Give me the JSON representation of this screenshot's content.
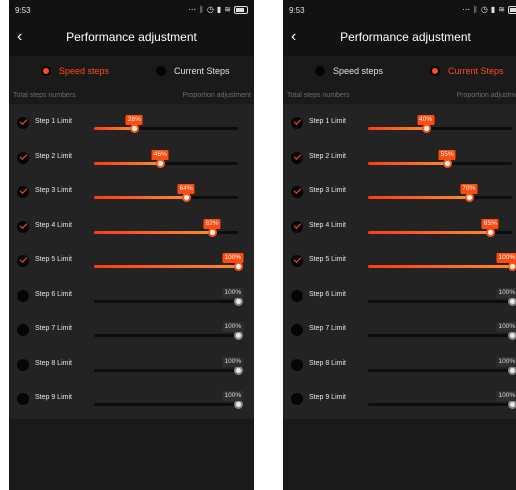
{
  "status_bar": {
    "time": "9:53",
    "icons": [
      "more-dots-icon",
      "bluetooth-icon",
      "alarm-icon",
      "signal-icon",
      "wifi-icon",
      "battery-icon"
    ]
  },
  "nav": {
    "back_icon": "chevron-left-icon",
    "title": "Performance adjustment"
  },
  "modes": {
    "speed_steps": "Speed steps",
    "current_steps": "Current Steps"
  },
  "headers": {
    "left": "Total steps numbers",
    "right": "Proportion adjustment"
  },
  "colors": {
    "accent": "#ff4d1a",
    "background": "#1a1a1a",
    "panel": "#232323"
  },
  "screens": [
    {
      "selected_mode": "speed_steps",
      "steps": [
        {
          "label": "Step 1 Limit",
          "enabled": true,
          "value": 28,
          "badge": "28%"
        },
        {
          "label": "Step 2 Limit",
          "enabled": true,
          "value": 46,
          "badge": "46%"
        },
        {
          "label": "Step 3 Limit",
          "enabled": true,
          "value": 64,
          "badge": "64%"
        },
        {
          "label": "Step 4 Limit",
          "enabled": true,
          "value": 82,
          "badge": "82%"
        },
        {
          "label": "Step 5 Limit",
          "enabled": true,
          "value": 100,
          "badge": "100%"
        },
        {
          "label": "Step 6 Limit",
          "enabled": false,
          "value": 100,
          "badge": "100%"
        },
        {
          "label": "Step 7 Limit",
          "enabled": false,
          "value": 100,
          "badge": "100%"
        },
        {
          "label": "Step 8 Limit",
          "enabled": false,
          "value": 100,
          "badge": "100%"
        },
        {
          "label": "Step 9 Limit",
          "enabled": false,
          "value": 100,
          "badge": "100%"
        }
      ]
    },
    {
      "selected_mode": "current_steps",
      "steps": [
        {
          "label": "Step 1 Limit",
          "enabled": true,
          "value": 40,
          "badge": "40%"
        },
        {
          "label": "Step 2 Limit",
          "enabled": true,
          "value": 55,
          "badge": "55%"
        },
        {
          "label": "Step 3 Limit",
          "enabled": true,
          "value": 70,
          "badge": "70%"
        },
        {
          "label": "Step 4 Limit",
          "enabled": true,
          "value": 85,
          "badge": "85%"
        },
        {
          "label": "Step 5 Limit",
          "enabled": true,
          "value": 100,
          "badge": "100%"
        },
        {
          "label": "Step 6 Limit",
          "enabled": false,
          "value": 100,
          "badge": "100%"
        },
        {
          "label": "Step 7 Limit",
          "enabled": false,
          "value": 100,
          "badge": "100%"
        },
        {
          "label": "Step 8 Limit",
          "enabled": false,
          "value": 100,
          "badge": "100%"
        },
        {
          "label": "Step 9 Limit",
          "enabled": false,
          "value": 100,
          "badge": "100%"
        }
      ]
    }
  ]
}
